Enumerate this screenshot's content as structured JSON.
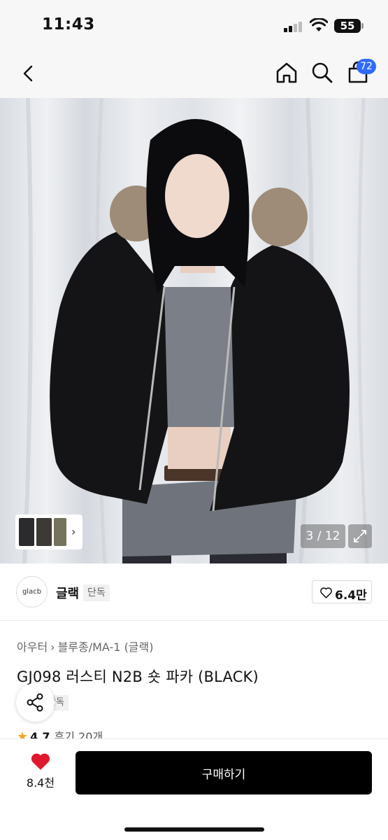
{
  "status_bar": {
    "time": "11:43",
    "battery": "55"
  },
  "nav": {
    "cart_count": "72"
  },
  "icons": {
    "back": "chevron-left-icon",
    "home": "home-icon",
    "search": "search-icon",
    "cart": "shopping-bag-icon",
    "share": "share-icon",
    "heart_outline": "heart-outline-icon",
    "heart_filled": "heart-filled-icon",
    "expand": "expand-icon",
    "star": "star-icon"
  },
  "gallery": {
    "counter": "3 / 12",
    "current": 3,
    "total": 12
  },
  "brand": {
    "logo_text": "glacb",
    "name": "글랙",
    "tag": "단독",
    "like_count": "6.4만"
  },
  "breadcrumb": {
    "category": "아우터",
    "subcategory": "블루종/MA-1 (글랙)"
  },
  "product": {
    "title": "GJ098 러스티 N2B 숏 파카 (BLACK)",
    "exclusive_tag": "단독",
    "rating": "4.7",
    "review_label": "후기 20개"
  },
  "bottom_bar": {
    "wish_count": "8.4천",
    "buy_label": "구매하기"
  },
  "colors": {
    "accent_blue": "#2f6bff",
    "heart_red": "#e0182d",
    "buy_button": "#000000",
    "star": "#f5a623"
  }
}
